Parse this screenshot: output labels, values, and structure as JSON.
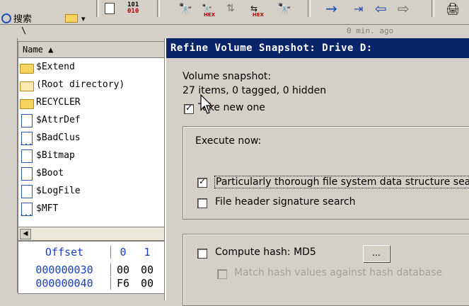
{
  "toolbar": {
    "search_label": "搜索",
    "icons": [
      "search-text-icon",
      "open-folder-icon",
      "copy-icon",
      "binary-icon",
      "find-icon",
      "find-hex-icon",
      "replace-icon",
      "replace-hex-icon",
      "find-again-icon",
      "goto-arrow-icon",
      "goto-offset-icon",
      "back-arrow-icon",
      "forward-arrow-icon",
      "print-icon"
    ]
  },
  "pathbar": {
    "path": "\\",
    "age": "0 min. ago"
  },
  "filelist": {
    "column_header": "Name ▲",
    "rows": [
      {
        "name": "$Extend",
        "icon": "folder-icon"
      },
      {
        "name": "(Root directory)",
        "icon": "root-folder-icon"
      },
      {
        "name": "RECYCLER",
        "icon": "folder-icon"
      },
      {
        "name": "$AttrDef",
        "icon": "file-icon"
      },
      {
        "name": "$BadClus",
        "icon": "sparse-file-icon"
      },
      {
        "name": "$Bitmap",
        "icon": "file-icon"
      },
      {
        "name": "$Boot",
        "icon": "file-icon"
      },
      {
        "name": "$LogFile",
        "icon": "file-icon"
      },
      {
        "name": "$MFT",
        "icon": "sparse-file-icon"
      }
    ]
  },
  "hexpanel": {
    "header_offset": "Offset",
    "header_col0": "0",
    "header_col1": "1",
    "rows": [
      {
        "offset": "000000030",
        "b0": "00",
        "b1": "00"
      },
      {
        "offset": "000000040",
        "b0": "F6",
        "b1": "00"
      }
    ]
  },
  "dialog": {
    "title": "Refine Volume Snapshot: Drive D:",
    "volume_snapshot_label": "Volume snapshot:",
    "snapshot_stats": "27 items, 0 tagged, 0 hidden",
    "take_new_one": "Take new one",
    "execute_now": "Execute now:",
    "thorough_search": "Particularly thorough file system data structure search",
    "header_signature": "File header signature search",
    "compute_hash": "Compute hash: MD5",
    "hash_button": "...",
    "match_hash": "Match hash values against hash database"
  }
}
